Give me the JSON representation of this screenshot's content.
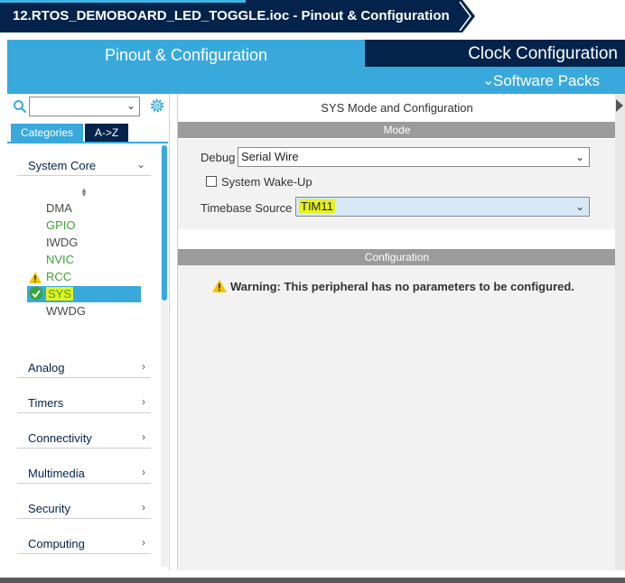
{
  "breadcrumb": {
    "title": "12.RTOS_DEMOBOARD_LED_TOGGLE.ioc - Pinout & Configuration"
  },
  "tabs": {
    "pinout": "Pinout & Configuration",
    "clock": "Clock Configuration",
    "software_packs": "Software Packs"
  },
  "sidebar": {
    "search_value": "",
    "category_tabs": [
      "Categories",
      "A->Z"
    ],
    "system_core": {
      "label": "System Core",
      "items": [
        {
          "label": "DMA",
          "state": "default"
        },
        {
          "label": "GPIO",
          "state": "configured"
        },
        {
          "label": "IWDG",
          "state": "default"
        },
        {
          "label": "NVIC",
          "state": "configured"
        },
        {
          "label": "RCC",
          "state": "warning"
        },
        {
          "label": "SYS",
          "state": "selected"
        },
        {
          "label": "WWDG",
          "state": "default"
        }
      ]
    },
    "groups": [
      "Analog",
      "Timers",
      "Connectivity",
      "Multimedia",
      "Security",
      "Computing"
    ]
  },
  "main": {
    "title": "SYS Mode and Configuration",
    "mode_section": "Mode",
    "debug_label": "Debug",
    "debug_value": "Serial Wire",
    "wakeup_label": "System Wake-Up",
    "wakeup_checked": false,
    "timebase_label": "Timebase Source",
    "timebase_value": "TIM11",
    "config_section": "Configuration",
    "warning": "Warning: This peripheral has no parameters to be configured."
  },
  "colors": {
    "navy": "#03234b",
    "accent_blue": "#39a9dc",
    "configured_green": "#3aa33a",
    "highlight_yellow": "#e6f21a",
    "warning_yellow": "#f5c400"
  }
}
